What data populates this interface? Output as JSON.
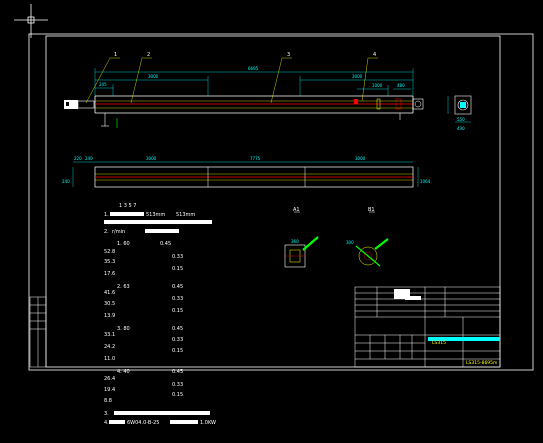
{
  "colors": {
    "background": "#000000",
    "frame": "#ffffff",
    "primary_line": "#ffffff",
    "dimension": "#00ffff",
    "centerline": "#ff0000",
    "leader": "#ffff00",
    "callout": "#00ff00",
    "highlight": "#ffff00"
  },
  "main_view": {
    "balloons": [
      "1",
      "2",
      "3",
      "4"
    ],
    "dims_top": [
      "6695",
      "3000",
      "3000"
    ],
    "dims_small": [
      "245",
      "1000",
      "480"
    ]
  },
  "plan_view": {
    "dims": [
      "220",
      "240",
      "3000",
      "7775",
      "3000"
    ],
    "left_dim": "240",
    "right_dim": "1064"
  },
  "end_view": {
    "dims": [
      "550",
      "430"
    ]
  },
  "section_views": {
    "labels": [
      "A1",
      "B1"
    ],
    "dim_a": "360",
    "dim_b": "300"
  },
  "notes": {
    "heading": "1 3 5 7",
    "lines": [
      {
        "label": "1.",
        "value": "513mm",
        "extra": "513mm"
      },
      {
        "label": "2.",
        "value": "r/min"
      },
      {
        "label": "1. 60",
        "col2": "0.45"
      },
      {
        "label": "52.8",
        "col2": ""
      },
      {
        "label": "35.3",
        "col2": "0.33"
      },
      {
        "label": "",
        "col2": "0.15"
      },
      {
        "label": "17.6",
        "col2": ""
      },
      {
        "label": "2. 63",
        "col2": "0.45"
      },
      {
        "label": "41.6",
        "col2": ""
      },
      {
        "label": "30.5",
        "col2": "0.33"
      },
      {
        "label": "",
        "col2": "0.15"
      },
      {
        "label": "13.9",
        "col2": ""
      },
      {
        "label": "3. 80",
        "col2": "0.45"
      },
      {
        "label": "33.1",
        "col2": ""
      },
      {
        "label": "24.2",
        "col2": "0.33"
      },
      {
        "label": "",
        "col2": "0.15"
      },
      {
        "label": "11.0",
        "col2": ""
      },
      {
        "label": "4. 40",
        "col2": "0.45"
      },
      {
        "label": "26.4",
        "col2": ""
      },
      {
        "label": "19.4",
        "col2": "0.33"
      },
      {
        "label": "",
        "col2": "0.15"
      },
      {
        "label": "8.8",
        "col2": ""
      }
    ],
    "footer_1": "3.",
    "footer_2": "4.",
    "motor": "6W04.0-B-25",
    "power": "1.0KW"
  },
  "title_block": {
    "drawing_no": "LS315-8695m",
    "name_code": "LS315"
  }
}
